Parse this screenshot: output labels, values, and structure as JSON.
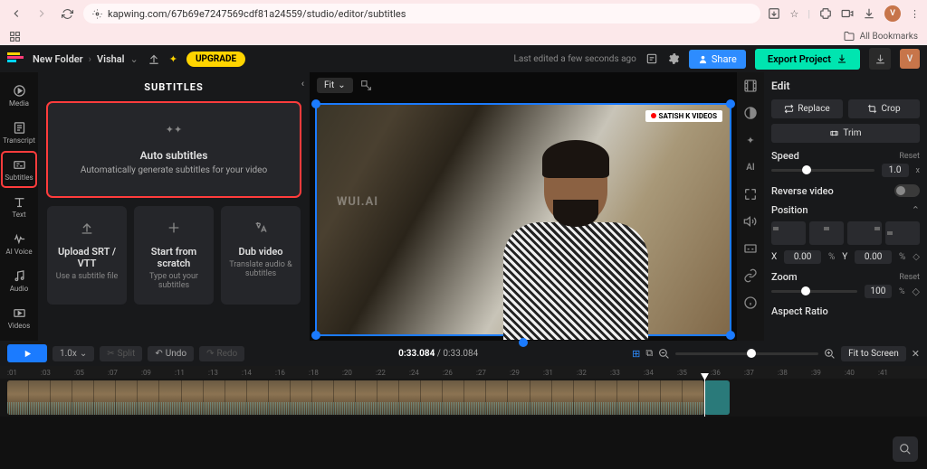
{
  "browser": {
    "url": "kapwing.com/67b69e7247569cdf81a24559/studio/editor/subtitles",
    "bookmarks_label": "All Bookmarks"
  },
  "appbar": {
    "crumb1": "New Folder",
    "crumb2": "Vishal",
    "upgrade": "UPGRADE",
    "status": "Last edited a few seconds ago",
    "share": "Share",
    "export": "Export Project",
    "avatar": "V"
  },
  "rail": {
    "media": "Media",
    "transcript": "Transcript",
    "subtitles": "Subtitles",
    "text": "Text",
    "aivoice": "AI Voice",
    "audio": "Audio",
    "videos": "Videos"
  },
  "panel": {
    "title": "SUBTITLES",
    "auto_title": "Auto subtitles",
    "auto_sub": "Automatically generate subtitles for your video",
    "upload_title": "Upload SRT / VTT",
    "upload_sub": "Use a subtitle file",
    "scratch_title": "Start from scratch",
    "scratch_sub": "Type out your subtitles",
    "dub_title": "Dub video",
    "dub_sub": "Translate audio & subtitles"
  },
  "canvas": {
    "fit": "Fit",
    "watermark": "SATISH K VIDEOS",
    "center_wm": "WUI.AI"
  },
  "edit": {
    "title": "Edit",
    "replace": "Replace",
    "crop": "Crop",
    "trim": "Trim",
    "speed": "Speed",
    "speed_val": "1.0",
    "speed_unit": "x",
    "reset": "Reset",
    "reverse": "Reverse video",
    "position": "Position",
    "x_label": "X",
    "x_val": "0.00",
    "y_label": "Y",
    "y_val": "0.00",
    "pct": "%",
    "zoom": "Zoom",
    "zoom_val": "100",
    "zoom_unit": "%",
    "aspect": "Aspect Ratio"
  },
  "timeline": {
    "speed": "1.0x",
    "split": "Split",
    "undo": "Undo",
    "redo": "Redo",
    "time_cur": "0:33.084",
    "time_total": "0:33.084",
    "fit_screen": "Fit to Screen",
    "ruler": [
      ":01",
      ":03",
      ":05",
      ":07",
      ":09",
      ":11",
      ":13",
      ":14",
      ":16",
      ":18",
      ":20",
      ":22",
      ":24",
      ":26",
      ":27",
      ":29",
      ":31",
      ":32",
      ":33",
      ":34",
      ":35",
      ":36",
      ":37",
      ":38",
      ":39",
      ":40",
      ":41"
    ]
  }
}
